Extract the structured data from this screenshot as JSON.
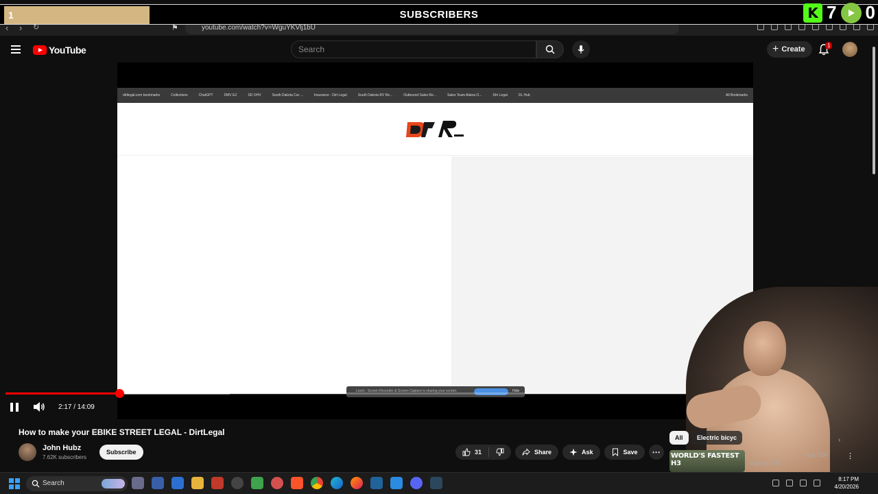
{
  "overlay": {
    "goal_value": "1",
    "title": "SUBSCRIBERS",
    "count_a": "7",
    "count_b": "0"
  },
  "browser": {
    "url": "youtube.com/watch?v=WguYKVlj1bU"
  },
  "masthead": {
    "logo_text": "YouTube",
    "search_placeholder": "Search",
    "create_label": "Create",
    "notification_count": "1"
  },
  "inner_browser": {
    "bookmarks": [
      "dirtlegal.com bookmarks",
      "Collections",
      "ChatGPT",
      "DMV EZ",
      "SD OHV",
      "South Dakota Car ...",
      "Insurance - Dirt Legal",
      "South Dakota RV Re...",
      "Outbound Sales Re...",
      "Sales Team Alaina O...",
      "Dirt Legal",
      "DL Hub",
      "All Bookmarks"
    ],
    "loom_text": "Loom - Screen Recorder & Screen Capture is sharing your screen.",
    "loom_stop": "Stop sharing",
    "loom_hide": "Hide"
  },
  "player": {
    "time": "2:17 / 14:09",
    "progress_fraction": 0.162,
    "buffered_fraction": 0.32,
    "state": "playing"
  },
  "video": {
    "title": "How to make your EBIKE STREET LEGAL - DirtLegal",
    "channel": "John Hubz",
    "subscribers": "7.62K subscribers",
    "subscribe_label": "Subscribe",
    "likes": "31",
    "share_label": "Share",
    "ask_label": "Ask",
    "save_label": "Save"
  },
  "recommendations": {
    "chip_all": "All",
    "chip_2": "Electric bicyc",
    "thumb_text": "WORLD'S FASTEST H3",
    "title": "Vipcoo H3?",
    "title_2": "est 72V"
  },
  "taskbar": {
    "search_label": "Search",
    "time": "8:17 PM",
    "date": "4/20/2026"
  },
  "colors": {
    "accent_red": "#ff0000",
    "overlay_goal": "#d4b683",
    "kick_green": "#53fc18",
    "rumble_green": "#85c742"
  }
}
